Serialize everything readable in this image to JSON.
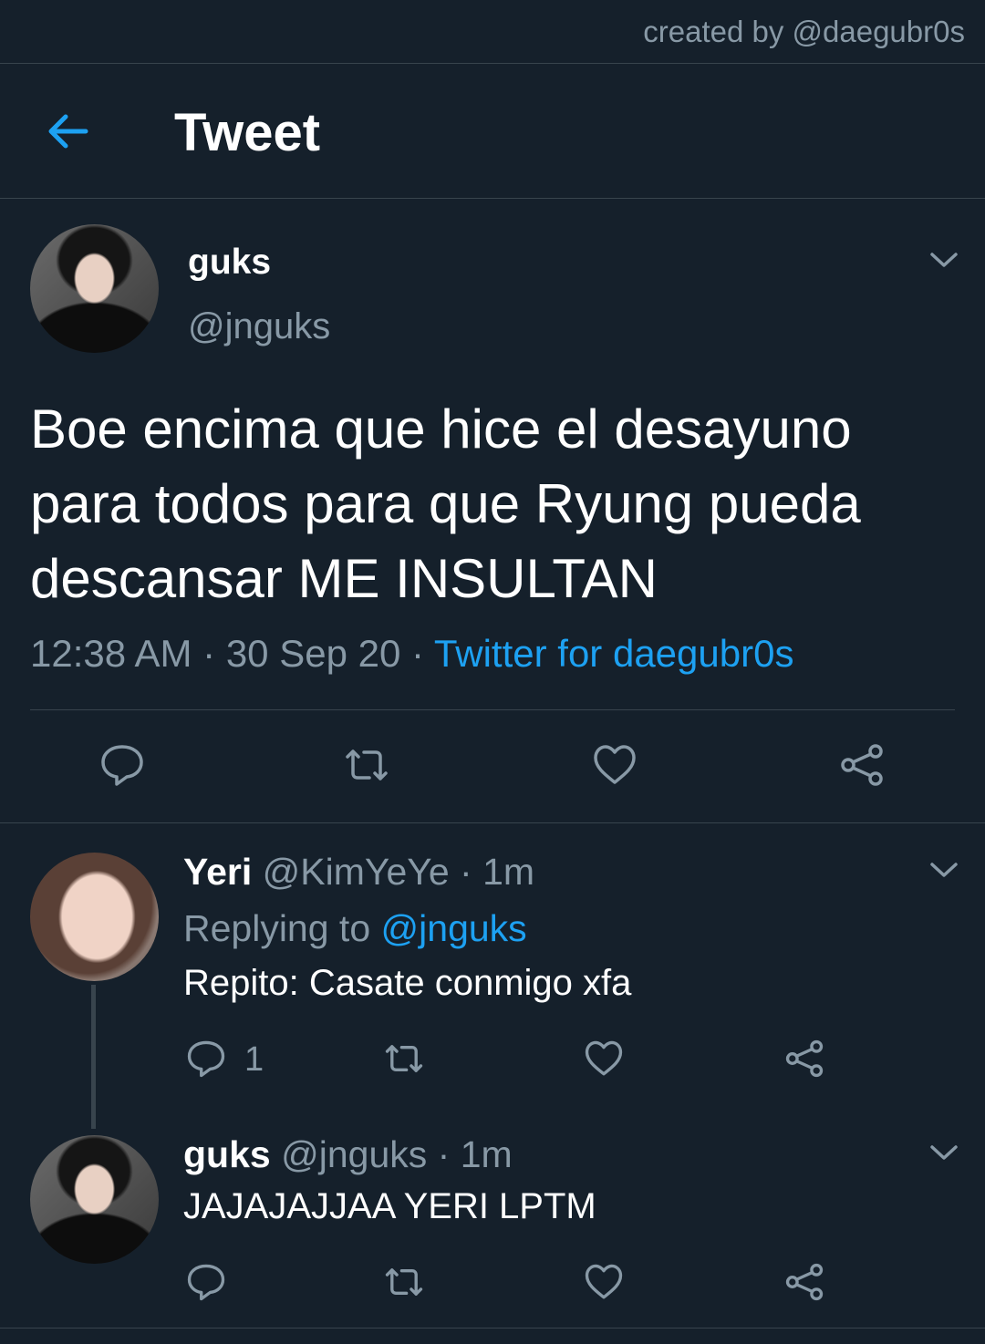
{
  "credit": "created by @daegubr0s",
  "header": {
    "title": "Tweet",
    "back_icon": "arrow-left-icon"
  },
  "main_tweet": {
    "name": "guks",
    "handle": "@jnguks",
    "text": "Boe encima que hice el desayuno para todos para que Ryung pueda descansar ME INSULTAN",
    "time": "12:38 AM",
    "date": "30 Sep 20",
    "separator": "·",
    "source": "Twitter for daegubr0s",
    "actions": [
      "reply-icon",
      "retweet-icon",
      "like-icon",
      "share-icon"
    ]
  },
  "replies": [
    {
      "name": "Yeri",
      "handle": "@KimYeYe",
      "age": "1m",
      "replying_prefix": "Replying to",
      "replying_to": "@jnguks",
      "text": "Repito: Casate conmigo xfa",
      "reply_count": "1"
    },
    {
      "name": "guks",
      "handle": "@jnguks",
      "age": "1m",
      "text": "JAJAJAJJAA YERI LPTM"
    }
  ],
  "colors": {
    "background": "#15202b",
    "accent": "#1da1f2",
    "muted": "#8899a6",
    "divider": "#38444d"
  }
}
